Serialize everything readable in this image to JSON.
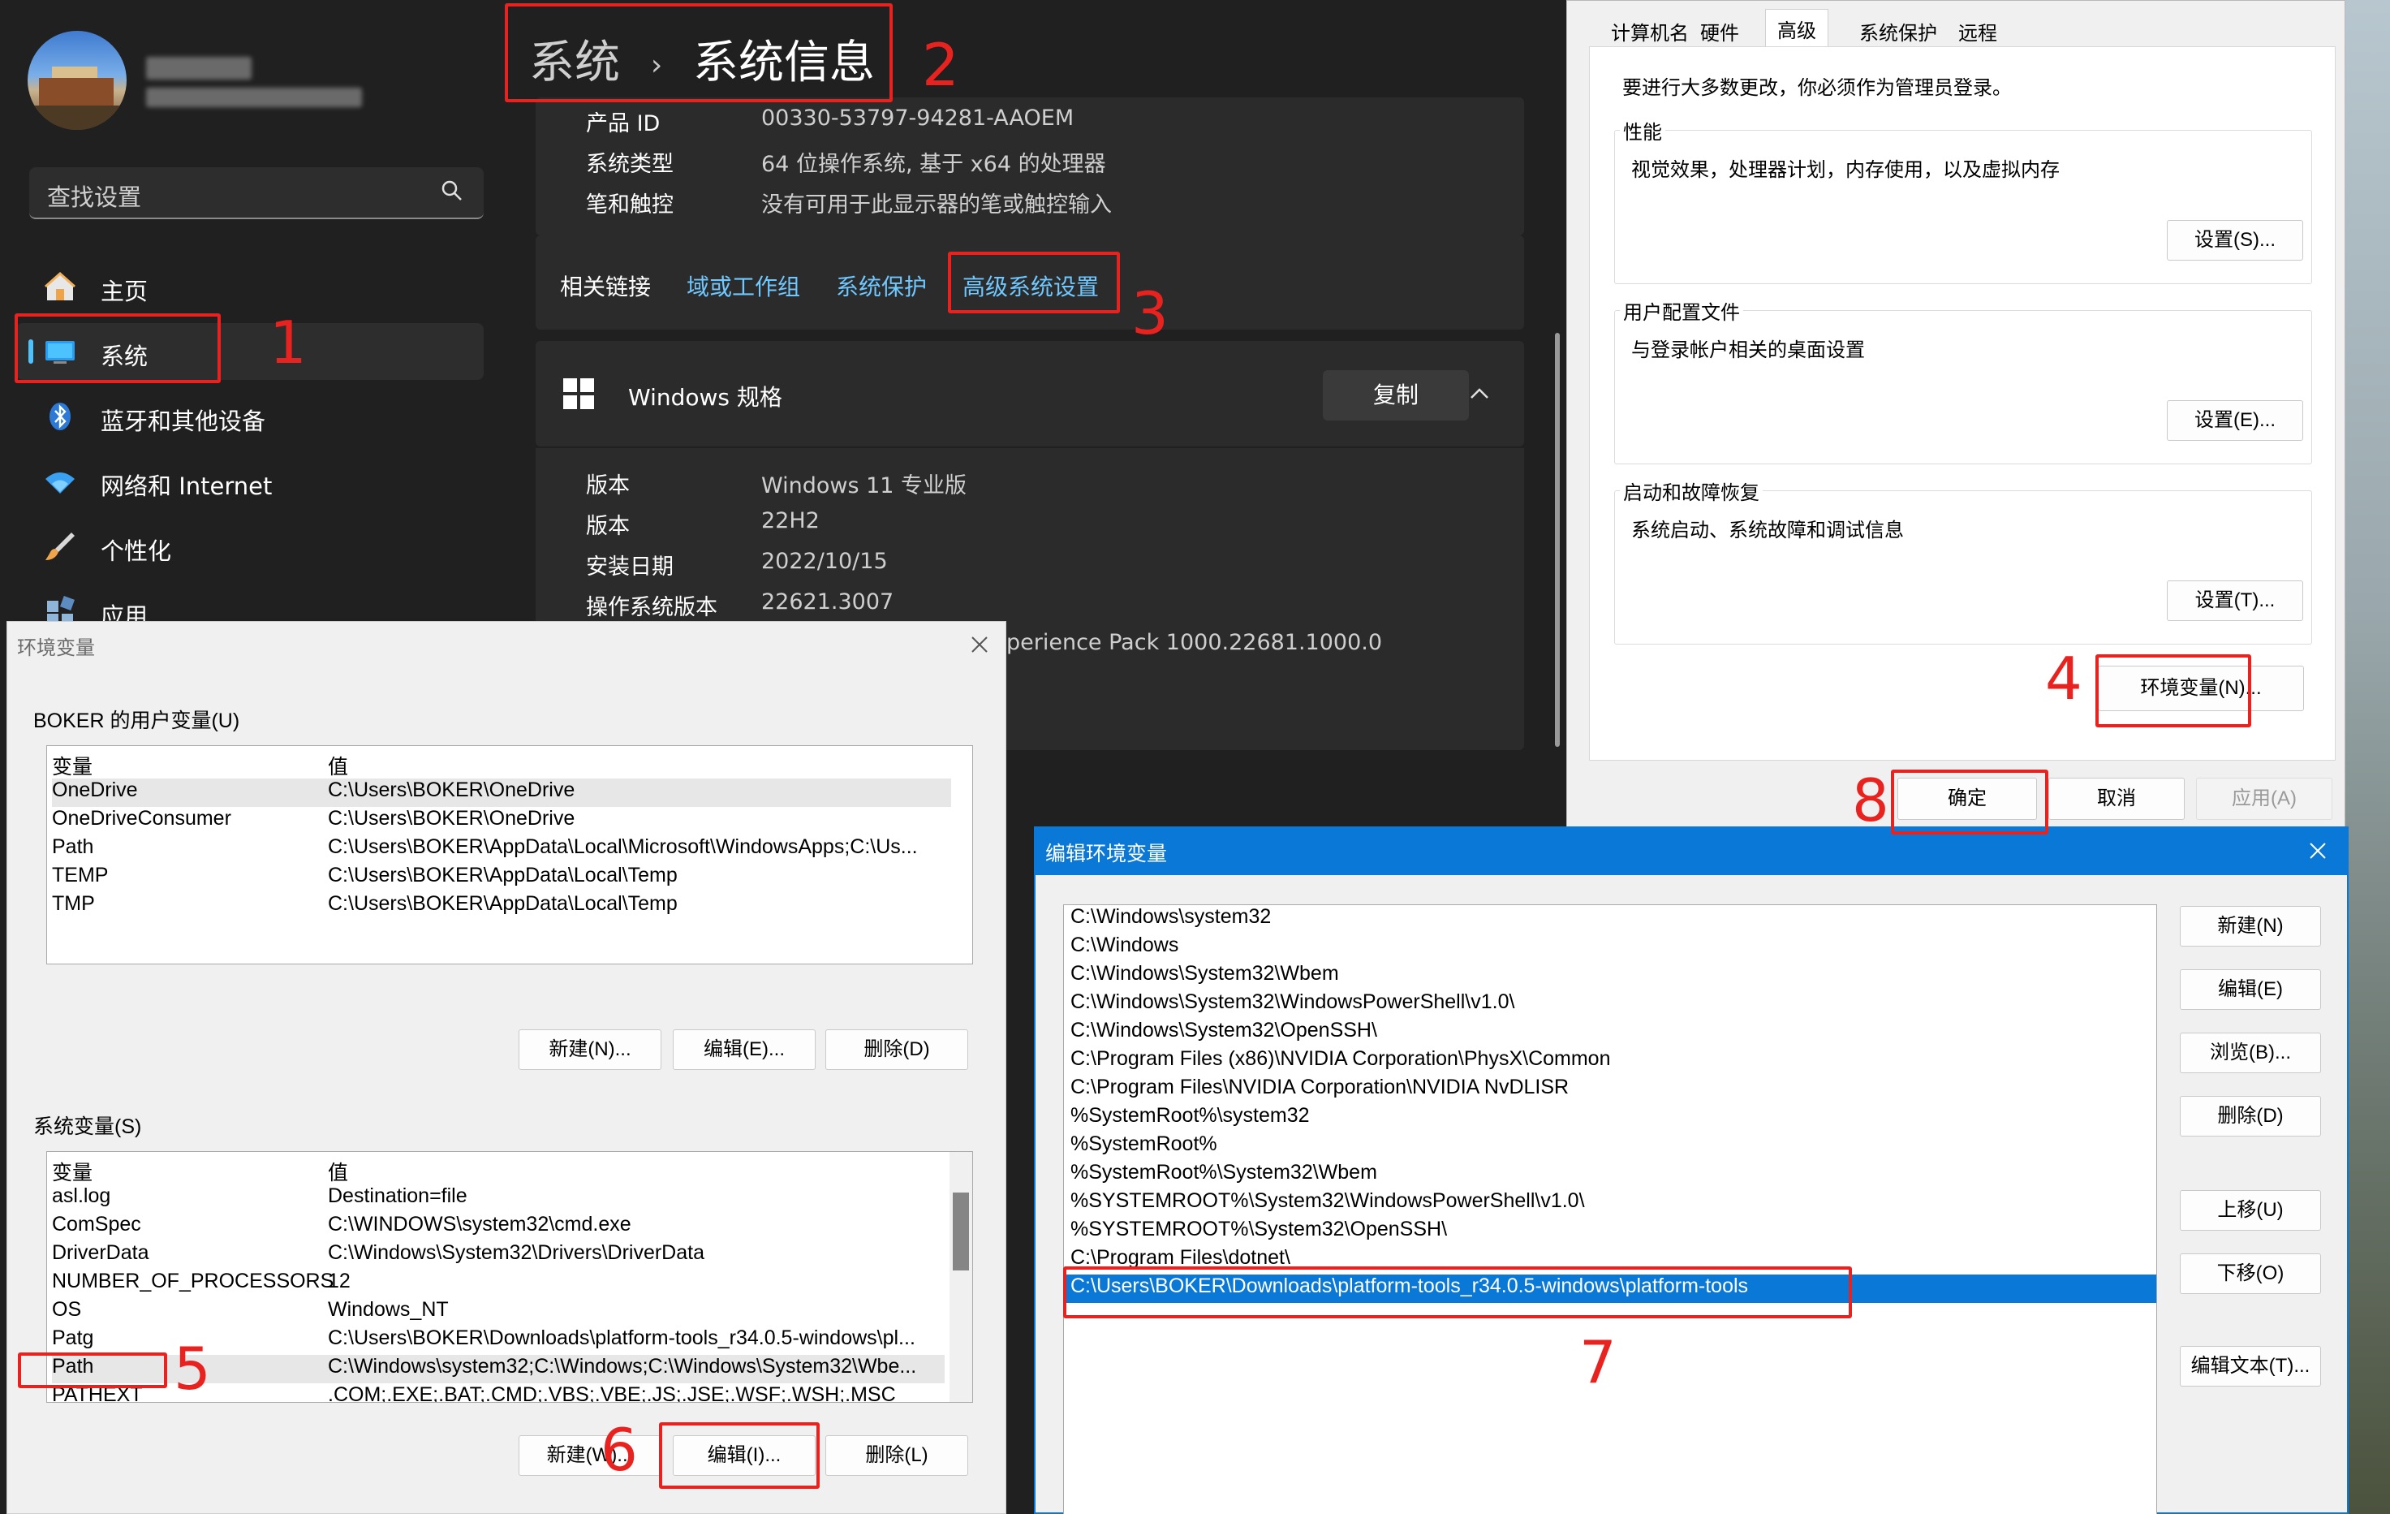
{
  "settings": {
    "user": {
      "name": "",
      "email": ""
    },
    "search_placeholder": "查找设置",
    "nav": [
      {
        "label": "主页",
        "icon": "home-icon"
      },
      {
        "label": "系统",
        "icon": "monitor-icon"
      },
      {
        "label": "蓝牙和其他设备",
        "icon": "bluetooth-icon"
      },
      {
        "label": "网络和 Internet",
        "icon": "wifi-icon"
      },
      {
        "label": "个性化",
        "icon": "brush-icon"
      },
      {
        "label": "应用",
        "icon": "apps-icon"
      }
    ],
    "breadcrumb": {
      "parent": "系统",
      "separator": "›",
      "current": "系统信息"
    },
    "device_specs": [
      {
        "k": "产品 ID",
        "v": "00330-53797-94281-AAOEM"
      },
      {
        "k": "系统类型",
        "v": "64 位操作系统, 基于 x64 的处理器"
      },
      {
        "k": "笔和触控",
        "v": "没有可用于此显示器的笔或触控输入"
      }
    ],
    "related_links": {
      "label": "相关链接",
      "items": [
        "域或工作组",
        "系统保护",
        "高级系统设置"
      ]
    },
    "win_spec": {
      "title": "Windows 规格",
      "copy_label": "复制",
      "rows": [
        {
          "k": "版本",
          "v": "Windows 11 专业版"
        },
        {
          "k": "版本",
          "v": "22H2"
        },
        {
          "k": "安装日期",
          "v": "2022/10/15"
        },
        {
          "k": "操作系统版本",
          "v": "22621.3007"
        }
      ],
      "experience_partial": "perience Pack 1000.22681.1000.0"
    }
  },
  "system_properties": {
    "tabs": [
      "计算机名",
      "硬件",
      "高级",
      "系统保护",
      "远程"
    ],
    "selected_tab": "高级",
    "admin_note": "要进行大多数更改，你必须作为管理员登录。",
    "groups": [
      {
        "title": "性能",
        "desc": "视觉效果，处理器计划，内存使用，以及虚拟内存",
        "button": "设置(S)..."
      },
      {
        "title": "用户配置文件",
        "desc": "与登录帐户相关的桌面设置",
        "button": "设置(E)..."
      },
      {
        "title": "启动和故障恢复",
        "desc": "系统启动、系统故障和调试信息",
        "button": "设置(T)..."
      }
    ],
    "env_button": "环境变量(N)...",
    "ok": "确定",
    "cancel": "取消",
    "apply": "应用(A)"
  },
  "env_dialog": {
    "title": "环境变量",
    "user_section": "BOKER 的用户变量(U)",
    "col_var": "变量",
    "col_val": "值",
    "user_vars": [
      {
        "name": "OneDrive",
        "value": "C:\\Users\\BOKER\\OneDrive"
      },
      {
        "name": "OneDriveConsumer",
        "value": "C:\\Users\\BOKER\\OneDrive"
      },
      {
        "name": "Path",
        "value": "C:\\Users\\BOKER\\AppData\\Local\\Microsoft\\WindowsApps;C:\\Us..."
      },
      {
        "name": "TEMP",
        "value": "C:\\Users\\BOKER\\AppData\\Local\\Temp"
      },
      {
        "name": "TMP",
        "value": "C:\\Users\\BOKER\\AppData\\Local\\Temp"
      }
    ],
    "user_buttons": [
      "新建(N)...",
      "编辑(E)...",
      "删除(D)"
    ],
    "sys_section": "系统变量(S)",
    "sys_vars": [
      {
        "name": "asl.log",
        "value": "Destination=file"
      },
      {
        "name": "ComSpec",
        "value": "C:\\WINDOWS\\system32\\cmd.exe"
      },
      {
        "name": "DriverData",
        "value": "C:\\Windows\\System32\\Drivers\\DriverData"
      },
      {
        "name": "NUMBER_OF_PROCESSORS",
        "value": "12"
      },
      {
        "name": "OS",
        "value": "Windows_NT"
      },
      {
        "name": "Patg",
        "value": "C:\\Users\\BOKER\\Downloads\\platform-tools_r34.0.5-windows\\pl..."
      },
      {
        "name": "Path",
        "value": "C:\\Windows\\system32;C:\\Windows;C:\\Windows\\System32\\Wbe..."
      },
      {
        "name": "PATHEXT",
        "value": ".COM;.EXE;.BAT;.CMD;.VBS;.VBE;.JS;.JSE;.WSF;.WSH;.MSC"
      }
    ],
    "sys_buttons": [
      "新建(W)...",
      "编辑(I)...",
      "删除(L)"
    ]
  },
  "edit_dialog": {
    "title": "编辑环境变量",
    "paths": [
      "C:\\Windows\\system32",
      "C:\\Windows",
      "C:\\Windows\\System32\\Wbem",
      "C:\\Windows\\System32\\WindowsPowerShell\\v1.0\\",
      "C:\\Windows\\System32\\OpenSSH\\",
      "C:\\Program Files (x86)\\NVIDIA Corporation\\PhysX\\Common",
      "C:\\Program Files\\NVIDIA Corporation\\NVIDIA NvDLISR",
      "%SystemRoot%\\system32",
      "%SystemRoot%",
      "%SystemRoot%\\System32\\Wbem",
      "%SYSTEMROOT%\\System32\\WindowsPowerShell\\v1.0\\",
      "%SYSTEMROOT%\\System32\\OpenSSH\\",
      "C:\\Program Files\\dotnet\\",
      "C:\\Users\\BOKER\\Downloads\\platform-tools_r34.0.5-windows\\platform-tools"
    ],
    "selected_index": 13,
    "buttons": [
      "新建(N)",
      "编辑(E)",
      "浏览(B)...",
      "删除(D)",
      "上移(U)",
      "下移(O)",
      "编辑文本(T)..."
    ]
  },
  "annotations": [
    "1",
    "2",
    "3",
    "4",
    "5",
    "6",
    "7",
    "8"
  ],
  "colors": {
    "accent": "#0a78d7",
    "link": "#6fc8ff",
    "annotation": "#e8231f"
  }
}
